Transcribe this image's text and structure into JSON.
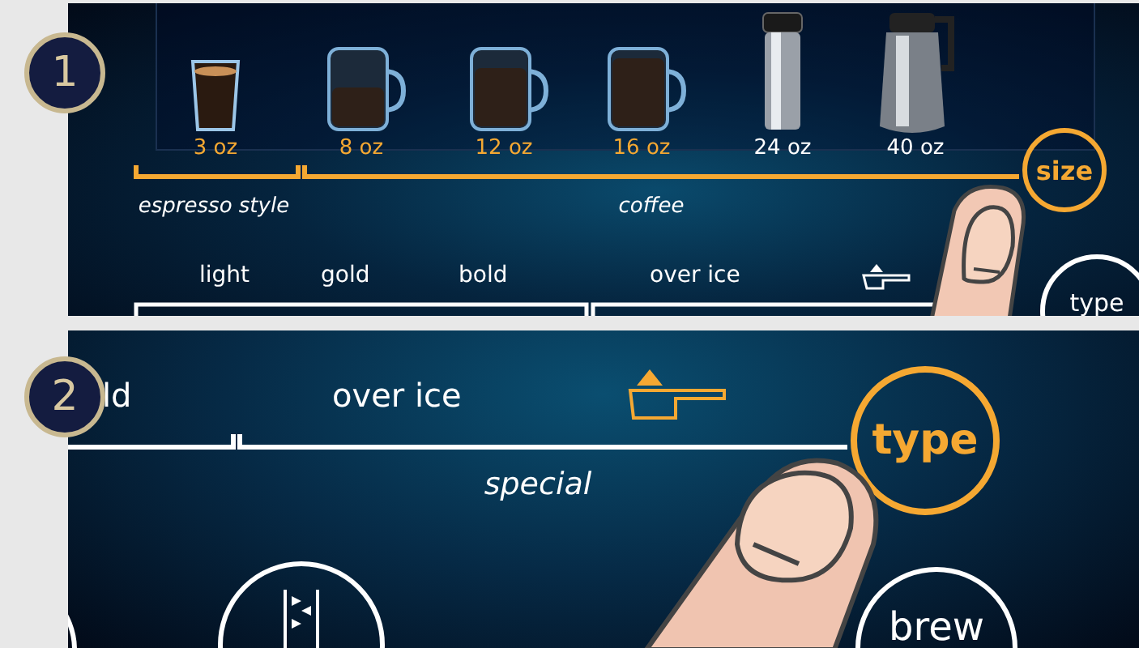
{
  "steps": [
    {
      "number": "1",
      "sizes": [
        {
          "label": "3 oz",
          "kind": "glass",
          "highlighted": true
        },
        {
          "label": "8 oz",
          "kind": "mug",
          "highlighted": true
        },
        {
          "label": "12 oz",
          "kind": "mug",
          "highlighted": true
        },
        {
          "label": "16 oz",
          "kind": "mug",
          "highlighted": true
        },
        {
          "label": "24 oz",
          "kind": "tumbler",
          "highlighted": false
        },
        {
          "label": "40 oz",
          "kind": "carafe",
          "highlighted": false
        }
      ],
      "size_groups": [
        "espresso style",
        "coffee"
      ],
      "size_button": {
        "label": "size",
        "highlighted": true
      },
      "types": [
        "light",
        "gold",
        "bold",
        "over ice"
      ],
      "scoop_highlighted": false,
      "type_button": {
        "label": "type",
        "highlighted": false
      }
    },
    {
      "number": "2",
      "types": [
        "ld",
        "over ice"
      ],
      "type_group": "special",
      "scoop_highlighted": true,
      "type_button": {
        "label": "type",
        "highlighted": true
      },
      "brew_button": {
        "label": "brew",
        "highlighted": false
      }
    }
  ]
}
